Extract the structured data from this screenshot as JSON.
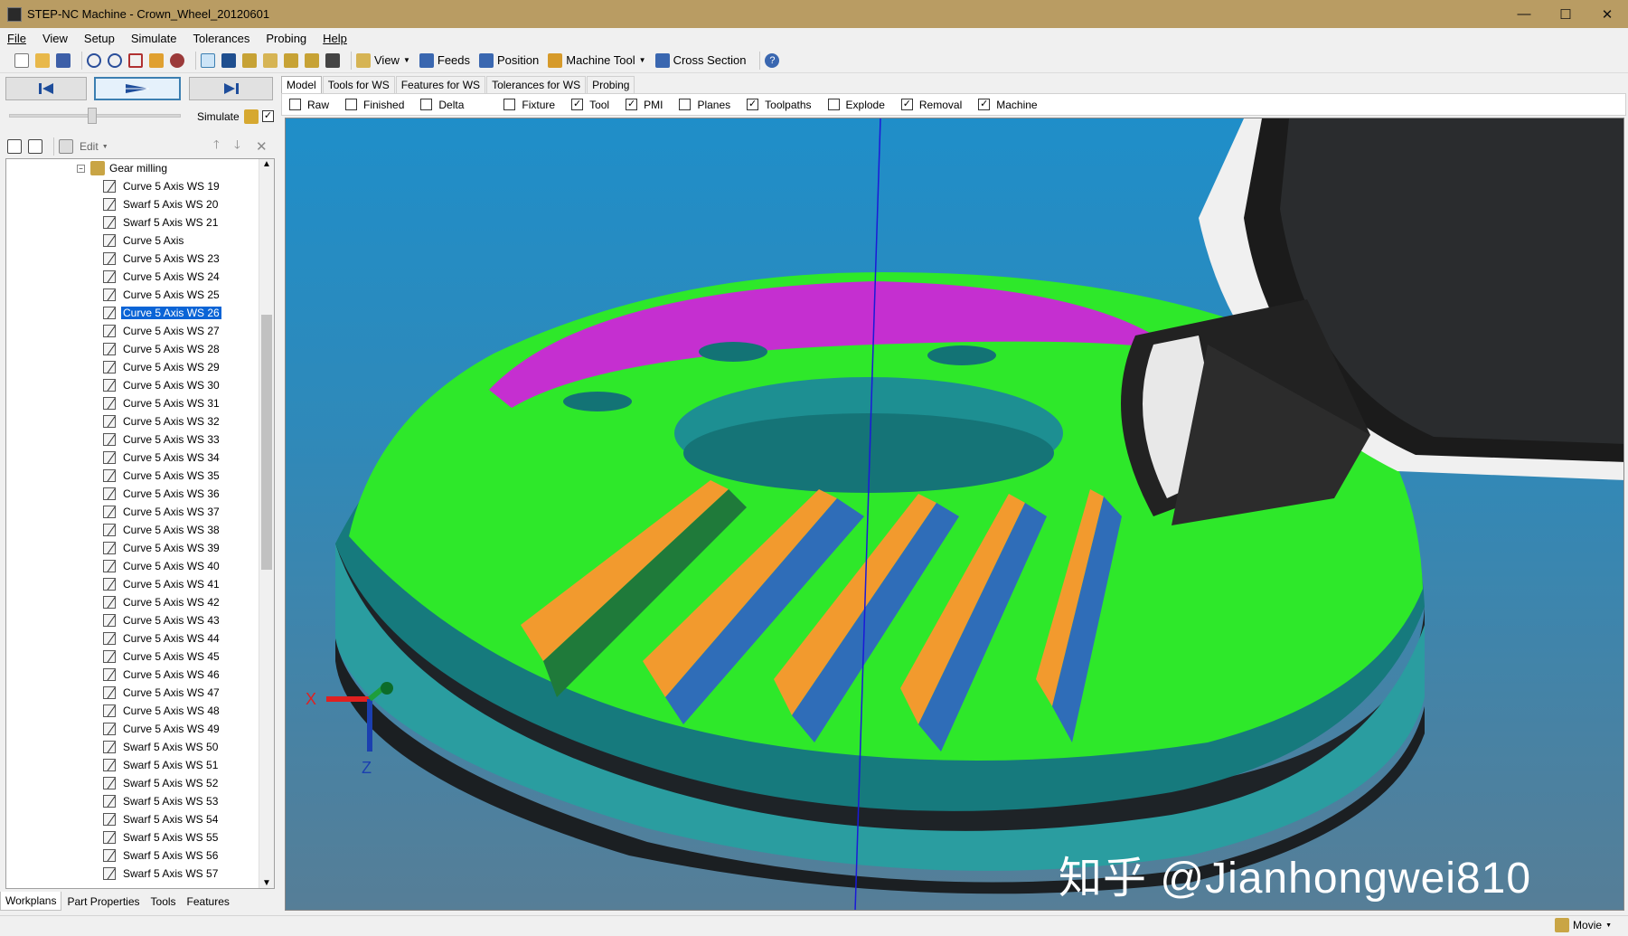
{
  "window": {
    "title": "STEP-NC Machine - Crown_Wheel_20120601",
    "controls": [
      "—",
      "☐",
      "✕"
    ]
  },
  "menu": [
    "File",
    "View",
    "Setup",
    "Simulate",
    "Tolerances",
    "Probing",
    "Help"
  ],
  "toolbar": {
    "view": "View",
    "feeds": "Feeds",
    "position": "Position",
    "machine_tool": "Machine Tool",
    "cross_section": "Cross Section"
  },
  "simulate": {
    "label": "Simulate",
    "checked": true
  },
  "tree_toolbar": {
    "edit": "Edit"
  },
  "tree": {
    "root": "Gear milling",
    "items": [
      "Curve 5 Axis WS 19",
      "Swarf 5 Axis WS 20",
      "Swarf 5 Axis WS 21",
      "Curve 5 Axis",
      "Curve 5 Axis WS 23",
      "Curve 5 Axis WS 24",
      "Curve 5 Axis WS 25",
      "Curve 5 Axis WS 26",
      "Curve 5 Axis WS 27",
      "Curve 5 Axis WS 28",
      "Curve 5 Axis WS 29",
      "Curve 5 Axis WS 30",
      "Curve 5 Axis WS 31",
      "Curve 5 Axis WS 32",
      "Curve 5 Axis WS 33",
      "Curve 5 Axis WS 34",
      "Curve 5 Axis WS 35",
      "Curve 5 Axis WS 36",
      "Curve 5 Axis WS 37",
      "Curve 5 Axis WS 38",
      "Curve 5 Axis WS 39",
      "Curve 5 Axis WS 40",
      "Curve 5 Axis WS 41",
      "Curve 5 Axis WS 42",
      "Curve 5 Axis WS 43",
      "Curve 5 Axis WS 44",
      "Curve 5 Axis WS 45",
      "Curve 5 Axis WS 46",
      "Curve 5 Axis WS 47",
      "Curve 5 Axis WS 48",
      "Curve 5 Axis WS 49",
      "Swarf 5 Axis WS 50",
      "Swarf 5 Axis WS 51",
      "Swarf 5 Axis WS 52",
      "Swarf 5 Axis WS 53",
      "Swarf 5 Axis WS 54",
      "Swarf 5 Axis WS 55",
      "Swarf 5 Axis WS 56",
      "Swarf 5 Axis WS 57"
    ],
    "selected": "Curve 5 Axis WS 26"
  },
  "left_tabs": [
    "Workplans",
    "Part Properties",
    "Tools",
    "Features"
  ],
  "view_tabs": [
    "Model",
    "Tools for WS",
    "Features for WS",
    "Tolerances for WS",
    "Probing"
  ],
  "filters": [
    {
      "label": "Raw",
      "checked": false
    },
    {
      "label": "Finished",
      "checked": false
    },
    {
      "label": "Delta",
      "checked": false
    },
    {
      "label": "Fixture",
      "checked": false
    },
    {
      "label": "Tool",
      "checked": true
    },
    {
      "label": "PMI",
      "checked": true
    },
    {
      "label": "Planes",
      "checked": false
    },
    {
      "label": "Toolpaths",
      "checked": true
    },
    {
      "label": "Explode",
      "checked": false
    },
    {
      "label": "Removal",
      "checked": true
    },
    {
      "label": "Machine",
      "checked": true
    }
  ],
  "viewport": {
    "axis_x": "X",
    "axis_z": "Z",
    "watermark": "知乎 @Jianhongwei810"
  },
  "status": {
    "movie": "Movie"
  },
  "colors": {
    "titlebar": "#b99c63",
    "selection": "#0a64d6",
    "gear_green": "#2ee82a",
    "gear_teal": "#2a9da0",
    "pocket_magenta": "#c52fd0",
    "tooth_orange": "#f29a2e",
    "tooth_blue": "#2f6db8"
  }
}
